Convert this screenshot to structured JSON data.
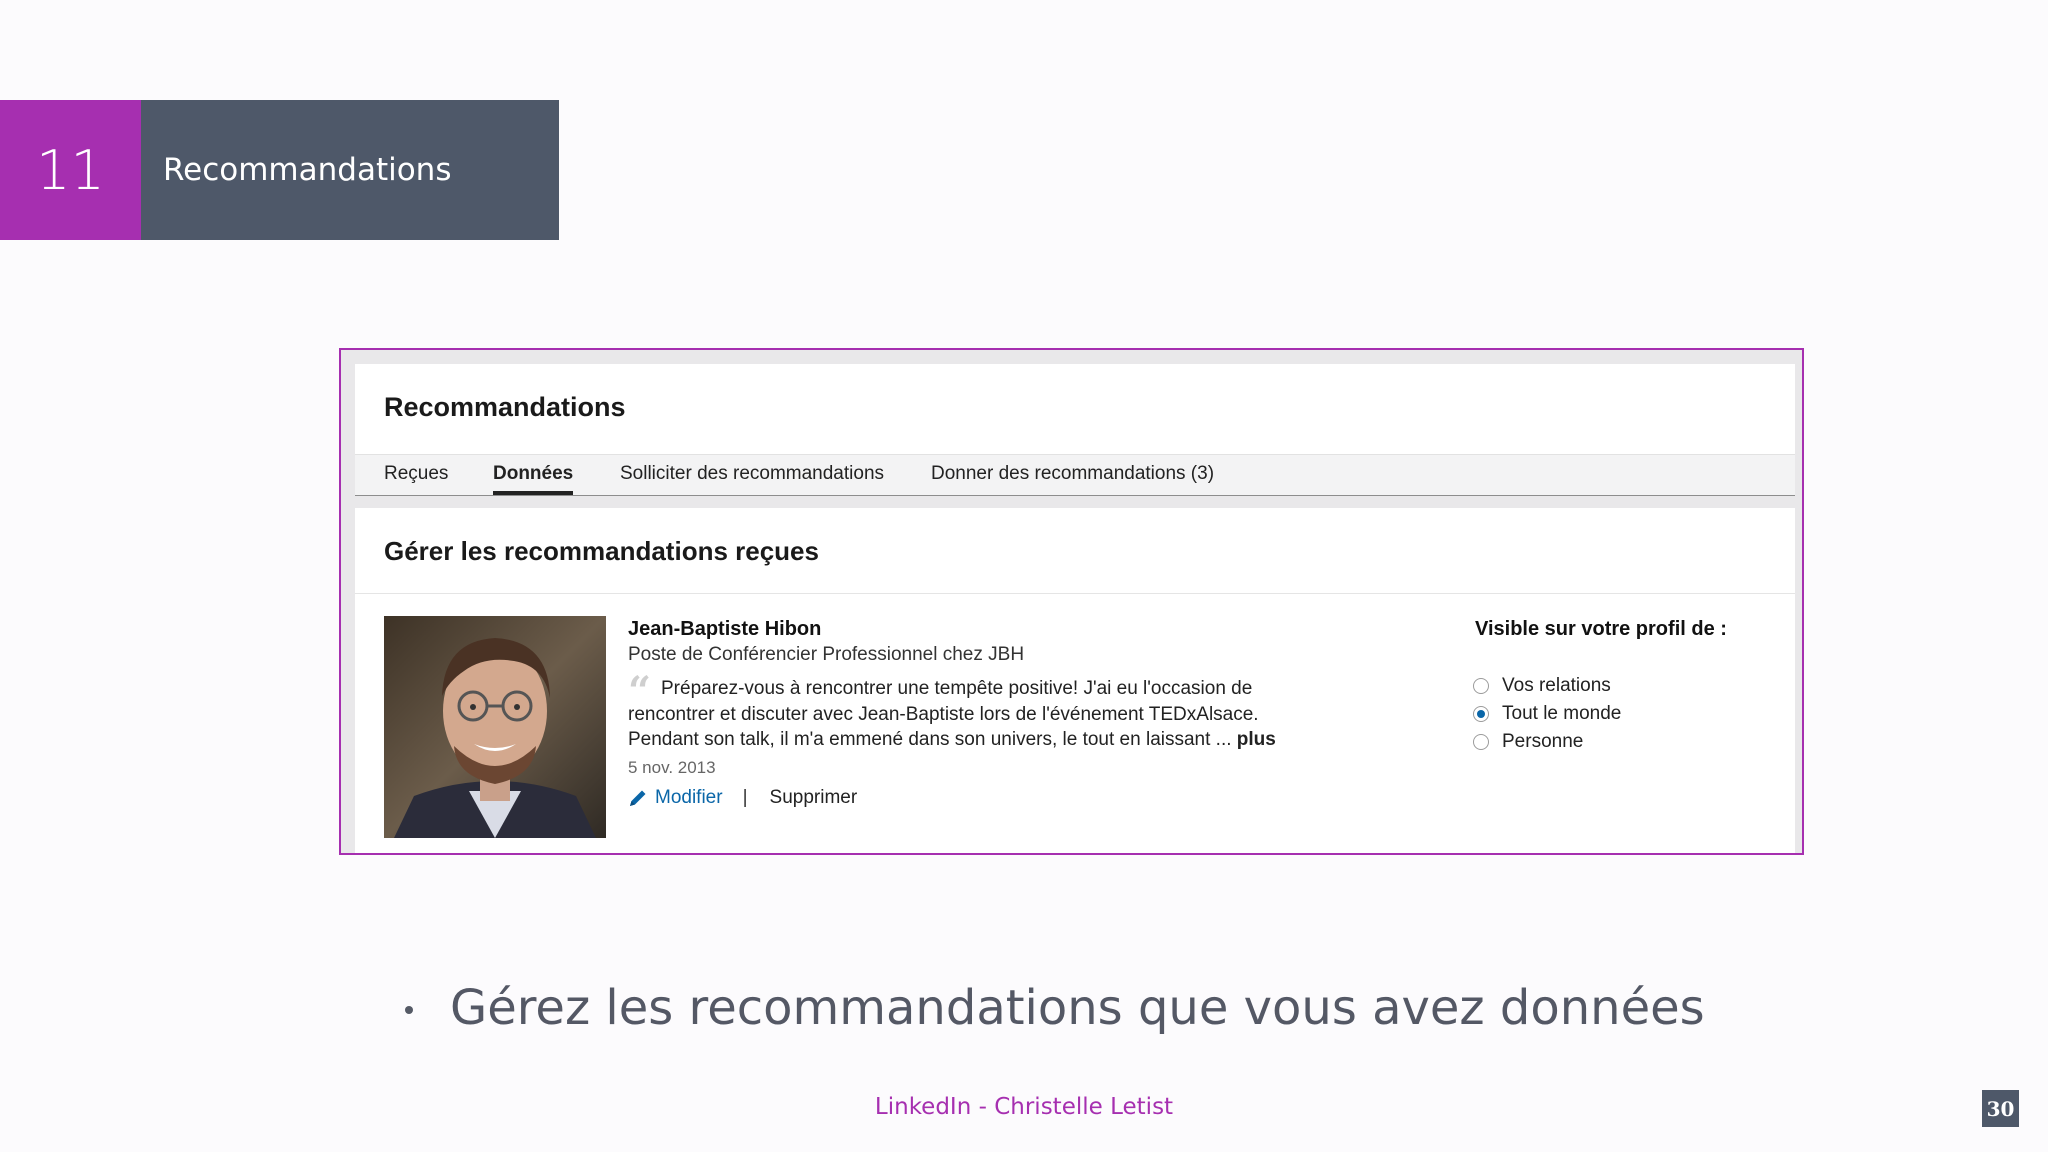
{
  "section": {
    "number": "11",
    "title": "Recommandations"
  },
  "screenshot": {
    "heading": "Recommandations",
    "tabs": [
      {
        "label": "Reçues",
        "active": false
      },
      {
        "label": "Données",
        "active": true
      },
      {
        "label": "Solliciter des recommandations",
        "active": false
      },
      {
        "label": "Donner des recommandations (3)",
        "active": false
      }
    ],
    "manage_title": "Gérer les recommandations reçues",
    "recommendation": {
      "photo_icon": "profile-photo",
      "name": "Jean-Baptiste Hibon",
      "position": "Poste de Conférencier Professionnel chez JBH",
      "quote_mark": "“",
      "text": "Préparez-vous à rencontrer une tempête positive! J'ai eu l'occasion de rencontrer et discuter avec Jean-Baptiste lors de l'événement TEDxAlsace. Pendant son talk, il m'a emmené dans son univers, le tout en laissant ...",
      "more": "plus",
      "date": "5 nov. 2013",
      "edit_label": "Modifier",
      "separator": "|",
      "delete_label": "Supprimer"
    },
    "visibility": {
      "title": "Visible sur votre profil de :",
      "options": [
        {
          "label": "Vos relations",
          "selected": false
        },
        {
          "label": "Tout le monde",
          "selected": true
        },
        {
          "label": "Personne",
          "selected": false
        }
      ]
    }
  },
  "bullet": "Gérez les recommandations que vous avez données",
  "footer": "LinkedIn  -  Christelle Letist",
  "page_number": "30",
  "colors": {
    "accent": "#a62fb0",
    "slate": "#4e5869",
    "link": "#0a66a8"
  }
}
